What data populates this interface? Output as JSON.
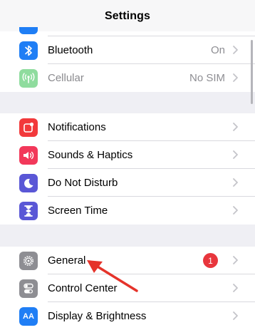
{
  "header": {
    "title": "Settings"
  },
  "section1": [
    {
      "label": "Bluetooth",
      "value": "On",
      "icon": "bluetooth-icon",
      "color": "#1f7ef5"
    },
    {
      "label": "Cellular",
      "value": "No SIM",
      "icon": "cellular-antenna-icon",
      "color": "#8fdc9e"
    }
  ],
  "section2": [
    {
      "label": "Notifications",
      "icon": "notifications-icon",
      "color": "#f2393b"
    },
    {
      "label": "Sounds & Haptics",
      "icon": "speaker-icon",
      "color": "#f2385a"
    },
    {
      "label": "Do Not Disturb",
      "icon": "moon-icon",
      "color": "#5a57d6"
    },
    {
      "label": "Screen Time",
      "icon": "hourglass-icon",
      "color": "#5a57d6"
    }
  ],
  "section3": [
    {
      "label": "General",
      "badge": "1",
      "icon": "gear-icon",
      "color": "#8e8e93"
    },
    {
      "label": "Control Center",
      "icon": "toggles-icon",
      "color": "#8e8e93"
    },
    {
      "label": "Display & Brightness",
      "icon": "display-text-icon",
      "icon_text": "AA",
      "color": "#1f7ef5"
    }
  ],
  "annotation": {
    "icon": "red-arrow-icon",
    "color": "#e5332a"
  }
}
